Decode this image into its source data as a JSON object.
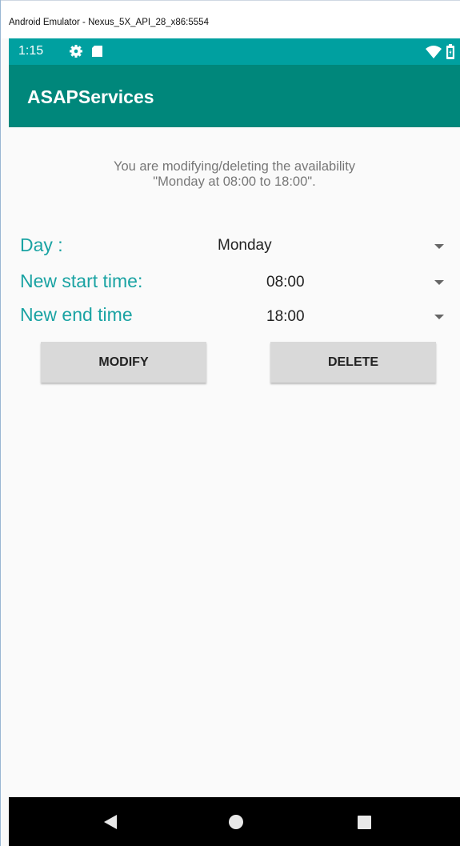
{
  "window": {
    "title": "Android Emulator - Nexus_5X_API_28_x86:5554"
  },
  "status_bar": {
    "time": "1:15",
    "icons": [
      "gear-icon",
      "sdcard-icon",
      "wifi-icon",
      "battery-icon"
    ]
  },
  "app_bar": {
    "title": "ASAPServices"
  },
  "info": {
    "line1": "You are modifying/deleting the availability",
    "line2": "\"Monday at 08:00 to 18:00\"."
  },
  "form": {
    "day_label": "Day :",
    "day_value": "Monday",
    "start_label": "New start time:",
    "start_value": "08:00",
    "end_label": "New end time",
    "end_value": "18:00"
  },
  "buttons": {
    "modify": "MODIFY",
    "delete": "DELETE"
  },
  "nav": {
    "icons": [
      "back-icon",
      "home-icon",
      "recents-icon"
    ]
  },
  "colors": {
    "status_bar": "#00a0a0",
    "app_bar": "#00877b",
    "label": "#1aa3a3",
    "button": "#d9d9d9",
    "nav_bar": "#000000"
  }
}
